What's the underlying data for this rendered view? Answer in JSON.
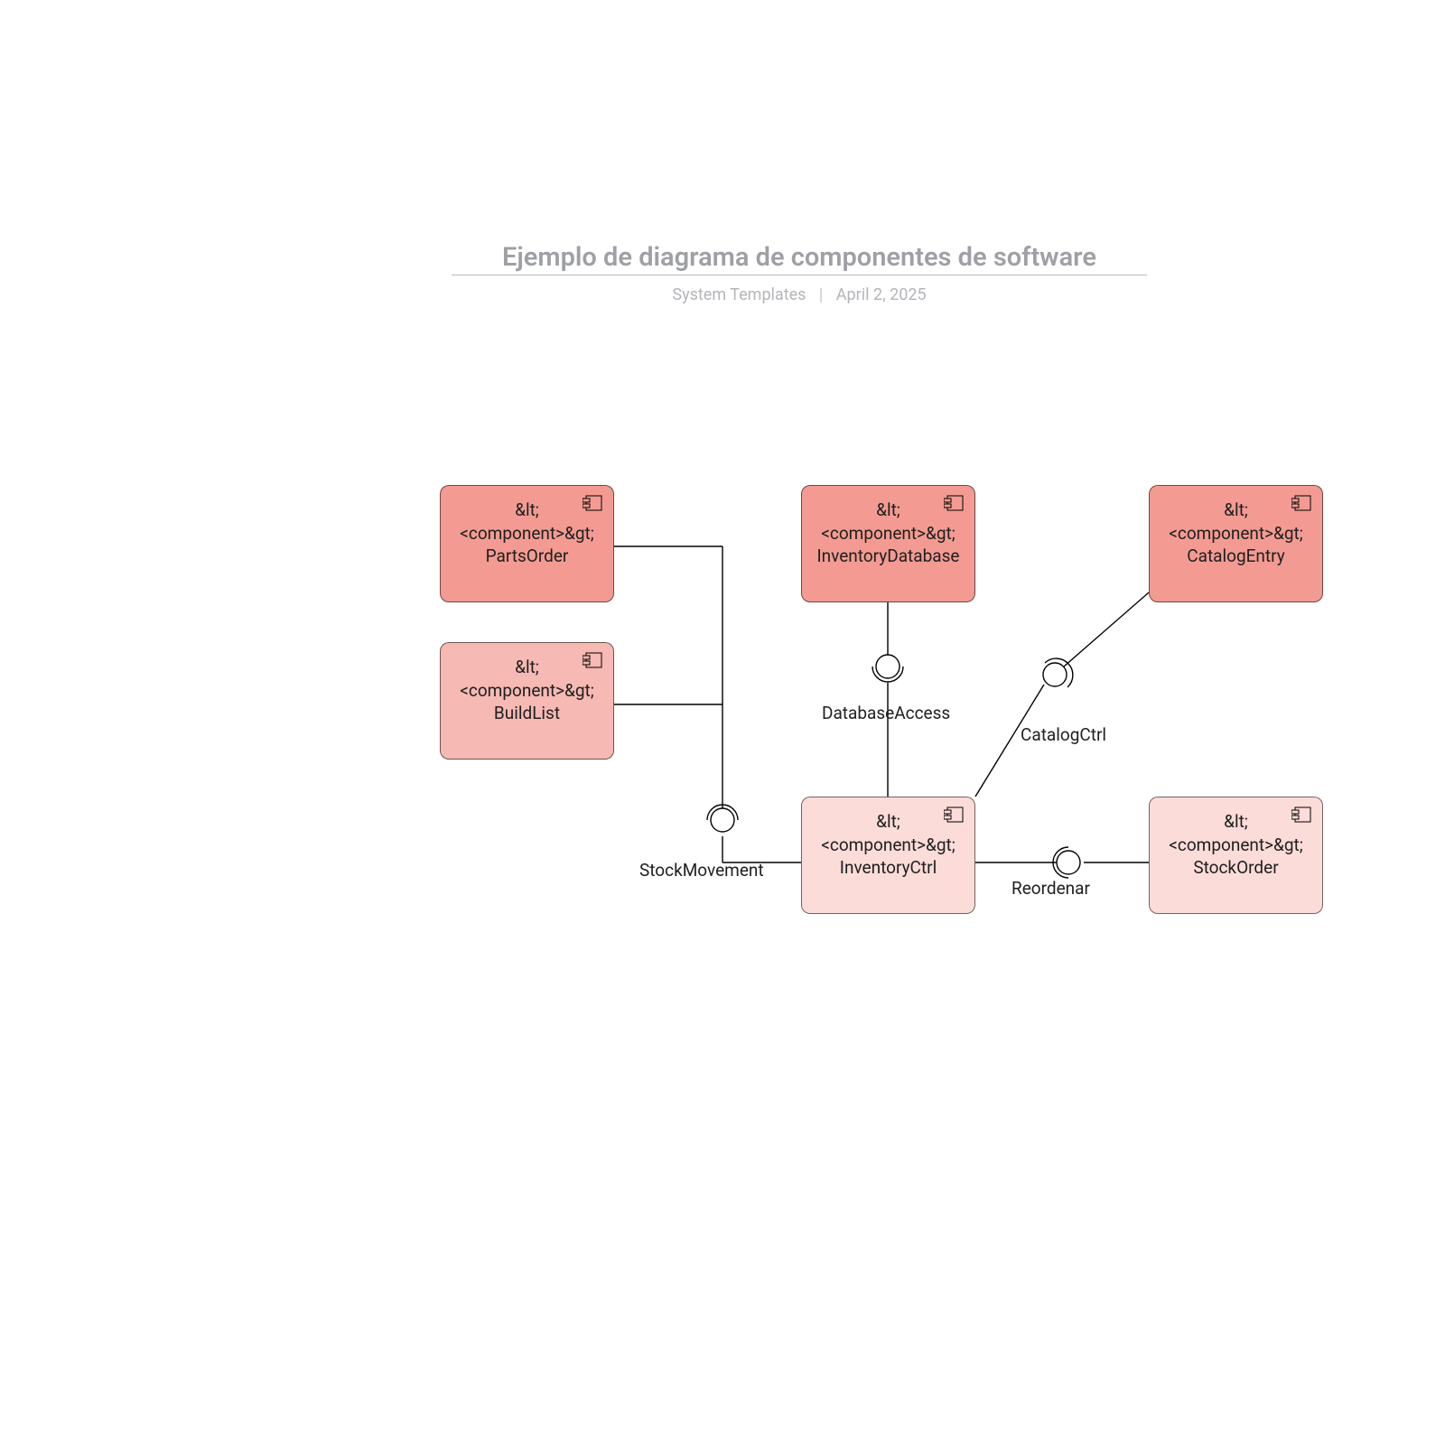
{
  "header": {
    "title": "Ejemplo de diagrama de componentes de software",
    "meta_left": "System Templates",
    "meta_right": "April 2, 2025"
  },
  "stereotype": "&lt;<component>&gt;",
  "components": {
    "parts_order": {
      "name": "PartsOrder"
    },
    "build_list": {
      "name": "BuildList"
    },
    "inventory_db": {
      "name": "InventoryDatabase"
    },
    "catalog_entry": {
      "name": "CatalogEntry"
    },
    "inventory_ctrl": {
      "name": "InventoryCtrl"
    },
    "stock_order": {
      "name": "StockOrder"
    }
  },
  "interfaces": {
    "stock_movement": "StockMovement",
    "database_access": "DatabaseAccess",
    "catalog_ctrl": "CatalogCtrl",
    "reorder": "Reordenar"
  }
}
